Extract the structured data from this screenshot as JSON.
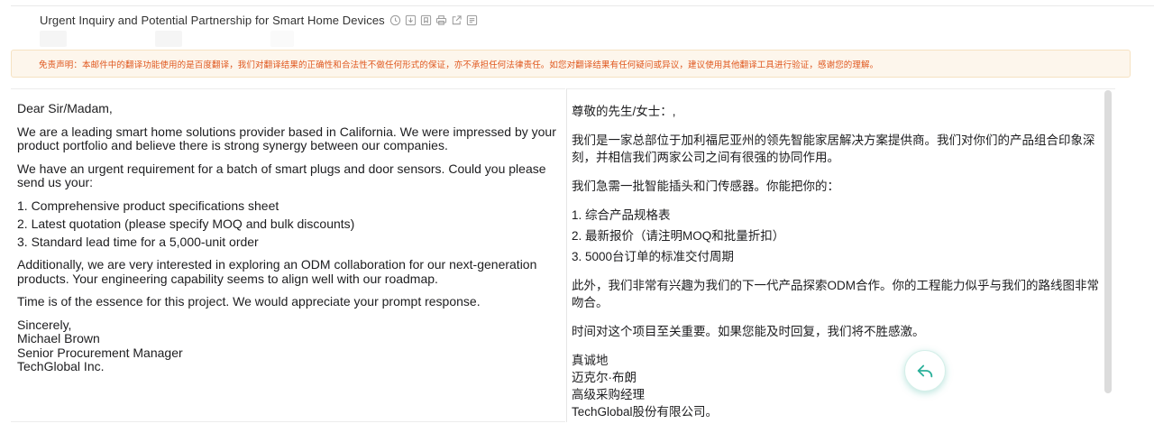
{
  "email": {
    "subject": "Urgent Inquiry and Potential Partnership for Smart Home Devices",
    "header_icons": [
      "clock-icon",
      "download-icon",
      "bookmark-icon",
      "print-icon",
      "open-external-icon",
      "note-icon"
    ]
  },
  "disclaimer": "免责声明：本邮件中的翻译功能使用的是百度翻译，我们对翻译结果的正确性和合法性不做任何形式的保证，亦不承担任何法律责任。如您对翻译结果有任何疑问或异议，建议使用其他翻译工具进行验证，感谢您的理解。",
  "original": {
    "greeting": "Dear Sir/Madam,",
    "intro": "We are a leading smart home solutions provider based in California. We were impressed by your product portfolio and believe there is strong synergy between our companies.",
    "request": "We have an urgent requirement for a batch of smart plugs and door sensors. Could you please send us your:",
    "items": [
      "1. Comprehensive product specifications sheet",
      "2. Latest quotation (please specify MOQ and bulk discounts)",
      "3. Standard lead time for a 5,000-unit order"
    ],
    "odm": "Additionally, we are very interested in exploring an ODM collaboration for our next-generation products. Your engineering capability seems to align well with our roadmap.",
    "closing_note": "Time is of the essence for this project. We would appreciate your prompt response.",
    "signoff": "Sincerely,",
    "name": "Michael Brown",
    "title": "Senior Procurement Manager",
    "company": "TechGlobal Inc."
  },
  "translation": {
    "greeting": "尊敬的先生/女士：,",
    "intro": "我们是一家总部位于加利福尼亚州的领先智能家居解决方案提供商。我们对你们的产品组合印象深刻，并相信我们两家公司之间有很强的协同作用。",
    "request": "我们急需一批智能插头和门传感器。你能把你的：",
    "items": [
      "1. 综合产品规格表",
      "2. 最新报价（请注明MOQ和批量折扣）",
      "3. 5000台订单的标准交付周期"
    ],
    "odm": "此外，我们非常有兴趣为我们的下一代产品探索ODM合作。你的工程能力似乎与我们的路线图非常吻合。",
    "closing_note": "时间对这个项目至关重要。如果您能及时回复，我们将不胜感激。",
    "signoff": "真诚地",
    "name": "迈克尔·布朗",
    "title": "高级采购经理",
    "company": "TechGlobal股份有限公司。"
  },
  "reply_button": {
    "icon": "reply-icon",
    "accent": "#2bb09a"
  }
}
